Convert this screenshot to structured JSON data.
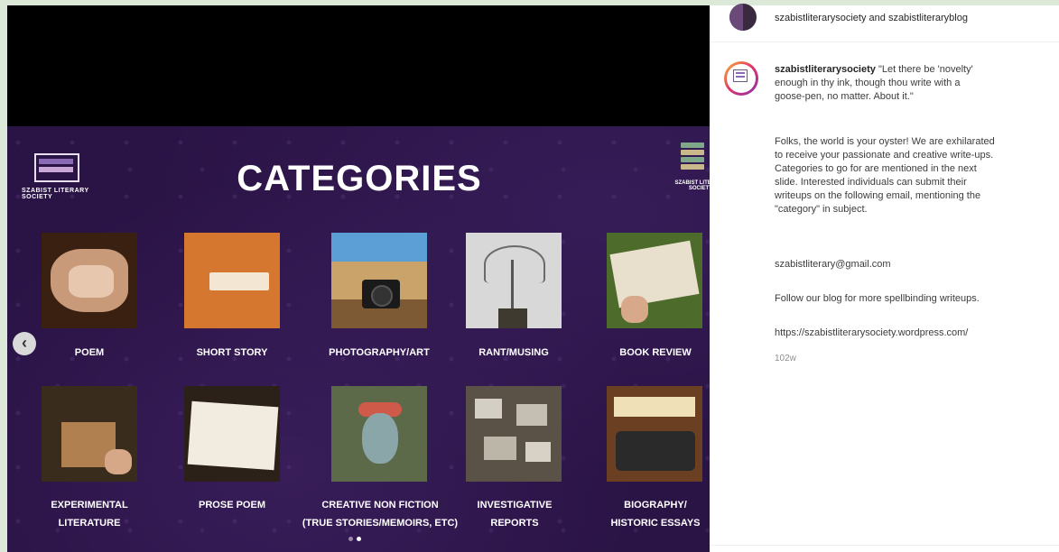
{
  "slide": {
    "title": "CATEGORIES",
    "logo_left_text": "SZABIST LITERARY SOCIETY",
    "logo_right_text": "SZABIST LITERARY SOCIETY",
    "categories_row1": [
      {
        "label": "POEM",
        "icon": "crumpled-paper-image"
      },
      {
        "label": "SHORT STORY",
        "icon": "torn-paper-image"
      },
      {
        "label": "PHOTOGRAPHY/ART",
        "icon": "camera-landscape-image"
      },
      {
        "label": "RANT/MUSING",
        "icon": "tree-hand-image"
      },
      {
        "label": "BOOK REVIEW",
        "icon": "open-book-image"
      }
    ],
    "categories_row2": [
      {
        "label1": "EXPERIMENTAL",
        "label2": "LITERATURE",
        "icon": "quill-writing-image"
      },
      {
        "label1": "PROSE POEM",
        "label2": "",
        "icon": "handwritten-note-image"
      },
      {
        "label1": "CREATIVE NON FICTION",
        "label2": "(TRUE STORIES/MEMOIRS, ETC)",
        "icon": "portrait-painting-image"
      },
      {
        "label1": "INVESTIGATIVE",
        "label2": "REPORTS",
        "icon": "evidence-board-image"
      },
      {
        "label1": "BIOGRAPHY/",
        "label2": "HISTORIC ESSAYS",
        "icon": "typewriter-image"
      }
    ],
    "carousel": {
      "total": 2,
      "active": 2
    }
  },
  "caption": {
    "header_users": "szabistliterarysociety and szabistliteraryblog",
    "username": "szabistliterarysociety",
    "quote_line1": "\"Let there be 'novelty'",
    "quote_line2": "enough in thy ink, though thou write with a",
    "quote_line3": "goose-pen, no matter. About it.\"",
    "para_line1": "Folks, the world is your oyster! We are exhilarated",
    "para_line2": "to receive your passionate and creative write-ups.",
    "para_line3": "Categories to go for are mentioned in the next",
    "para_line4": "slide. Interested individuals can submit their",
    "para_line5": "writeups on the following email, mentioning the",
    "para_line6": "\"category\" in subject.",
    "email": "szabistliterary@gmail.com",
    "follow": "Follow our blog for more spellbinding writeups.",
    "url": "https://szabistliterarysociety.wordpress.com/",
    "time": "102w"
  },
  "colors": {
    "slide_bg": "#2a1345",
    "accent_ring": "#e1306c"
  }
}
